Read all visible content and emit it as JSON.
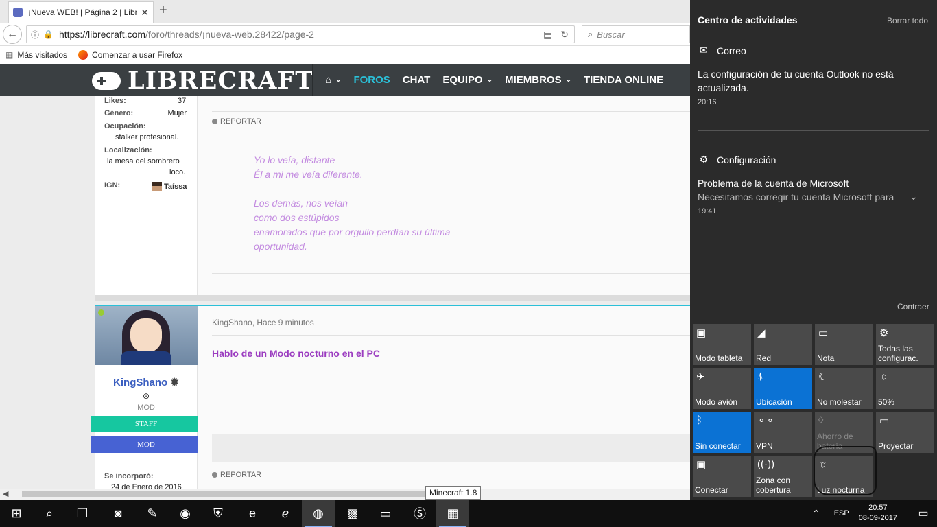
{
  "browser": {
    "tab_title": "¡Nueva WEB! | Página 2 | Libr",
    "url_host": "https://librecraft.com",
    "url_path": "/foro/threads/¡nueva-web.28422/page-2",
    "search_placeholder": "Buscar",
    "bookmarks": [
      "Más visitados",
      "Comenzar a usar Firefox"
    ]
  },
  "site": {
    "logo": "LIBRECRAFT",
    "nav": {
      "foros": "FOROS",
      "chat": "CHAT",
      "equipo": "EQUIPO",
      "miembros": "MIEMBROS",
      "tienda": "TIENDA ONLINE"
    }
  },
  "post1": {
    "likes_label": "Likes:",
    "likes_value": "37",
    "genero_label": "Género:",
    "genero_value": "Mujer",
    "ocupacion_label": "Ocupación:",
    "ocupacion_value": "stalker profesional.",
    "localizacion_label": "Localización:",
    "localizacion_value_1": "la mesa del sombrero",
    "localizacion_value_2": "loco.",
    "ign_label": "IGN:",
    "ign_value": "Taíssa",
    "report": "REPORTAR",
    "poem": [
      "Yo lo veía, distante",
      "Él a mi me veía diferente.",
      "",
      "Los demás, nos veían",
      "como dos estúpidos",
      "enamorados que por orgullo perdían su última",
      "oportunidad."
    ]
  },
  "post2": {
    "username": "KingShano",
    "user_title": "MOD",
    "role1": "STAFF",
    "role2": "MOD",
    "author_line": "KingShano, Hace 9 minutos",
    "text": "Hablo de un Modo nocturno en el PC",
    "joined_label": "Se incorporó:",
    "joined_value": "24 de Enero de 2016",
    "report": "REPORTAR"
  },
  "tooltip": "Minecraft 1.8",
  "action_center": {
    "title": "Centro de actividades",
    "clear_all": "Borrar todo",
    "mail": {
      "group": "Correo",
      "body": [
        "La configuración de tu cuenta Outlook no está",
        "actualizada."
      ],
      "time": "20:16"
    },
    "config": {
      "group": "Configuración",
      "title": "Problema de la cuenta de Microsoft",
      "body": "Necesitamos corregir tu cuenta Microsoft para",
      "time": "19:41"
    },
    "collapse": "Contraer",
    "tiles": [
      {
        "label": "Modo tableta",
        "icon": "tablet-icon",
        "state": "off"
      },
      {
        "label": "Red",
        "icon": "network-icon",
        "state": "off"
      },
      {
        "label": "Nota",
        "icon": "note-icon",
        "state": "off"
      },
      {
        "label": "Todas las configurac.",
        "icon": "gear-icon",
        "state": "off"
      },
      {
        "label": "Modo avión",
        "icon": "airplane-icon",
        "state": "off"
      },
      {
        "label": "Ubicación",
        "icon": "location-icon",
        "state": "on"
      },
      {
        "label": "No molestar",
        "icon": "moon-icon",
        "state": "off"
      },
      {
        "label": "50%",
        "icon": "brightness-icon",
        "state": "off"
      },
      {
        "label": "Sin conectar",
        "icon": "bluetooth-icon",
        "state": "on"
      },
      {
        "label": "VPN",
        "icon": "vpn-icon",
        "state": "off"
      },
      {
        "label": "Ahorro de batería",
        "icon": "battery-saver-icon",
        "state": "disabled"
      },
      {
        "label": "Proyectar",
        "icon": "project-icon",
        "state": "off"
      },
      {
        "label": "Conectar",
        "icon": "connect-icon",
        "state": "off"
      },
      {
        "label": "Zona con cobertura",
        "icon": "hotspot-icon",
        "state": "off"
      },
      {
        "label": "Luz nocturna",
        "icon": "night-light-icon",
        "state": "off"
      }
    ]
  },
  "taskbar": {
    "language": "ESP",
    "time": "20:57",
    "date": "08-09-2017"
  }
}
